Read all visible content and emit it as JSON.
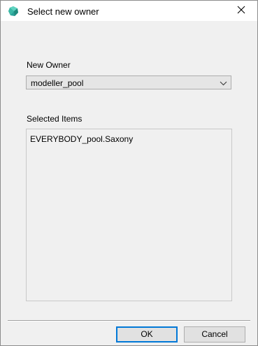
{
  "window": {
    "title": "Select new owner",
    "app_icon": "teal-polyhedron-icon",
    "close_icon": "close-icon"
  },
  "form": {
    "owner_label": "New Owner",
    "owner_value": "modeller_pool",
    "items_label": "Selected Items",
    "items": [
      "EVERYBODY_pool.Saxony"
    ]
  },
  "buttons": {
    "ok_label": "OK",
    "cancel_label": "Cancel"
  },
  "colors": {
    "accent": "#0078d7",
    "icon_teal": "#2aa198"
  }
}
